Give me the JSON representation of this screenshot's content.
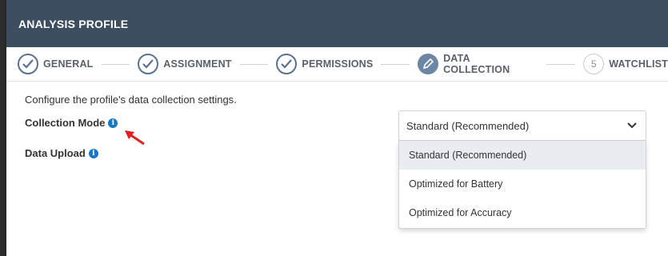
{
  "dialog": {
    "title": "ANALYSIS PROFILE"
  },
  "steps": [
    {
      "label": "GENERAL",
      "state": "done"
    },
    {
      "label": "ASSIGNMENT",
      "state": "done"
    },
    {
      "label": "PERMISSIONS",
      "state": "done"
    },
    {
      "label": "DATA COLLECTION",
      "state": "active"
    },
    {
      "label": "WATCHLIST",
      "state": "todo",
      "number": "5"
    }
  ],
  "content": {
    "intro": "Configure the profile's data collection settings.",
    "collection_mode_label": "Collection Mode",
    "data_upload_label": "Data Upload",
    "info_glyph": "i"
  },
  "collection_mode_select": {
    "value": "Standard (Recommended)",
    "options": [
      "Standard (Recommended)",
      "Optimized for Battery",
      "Optimized for Accuracy"
    ],
    "selected_index": 0
  },
  "colors": {
    "header_bg": "#3c4e60",
    "info_icon": "#1a78c2",
    "annotation_arrow": "#e02020"
  }
}
